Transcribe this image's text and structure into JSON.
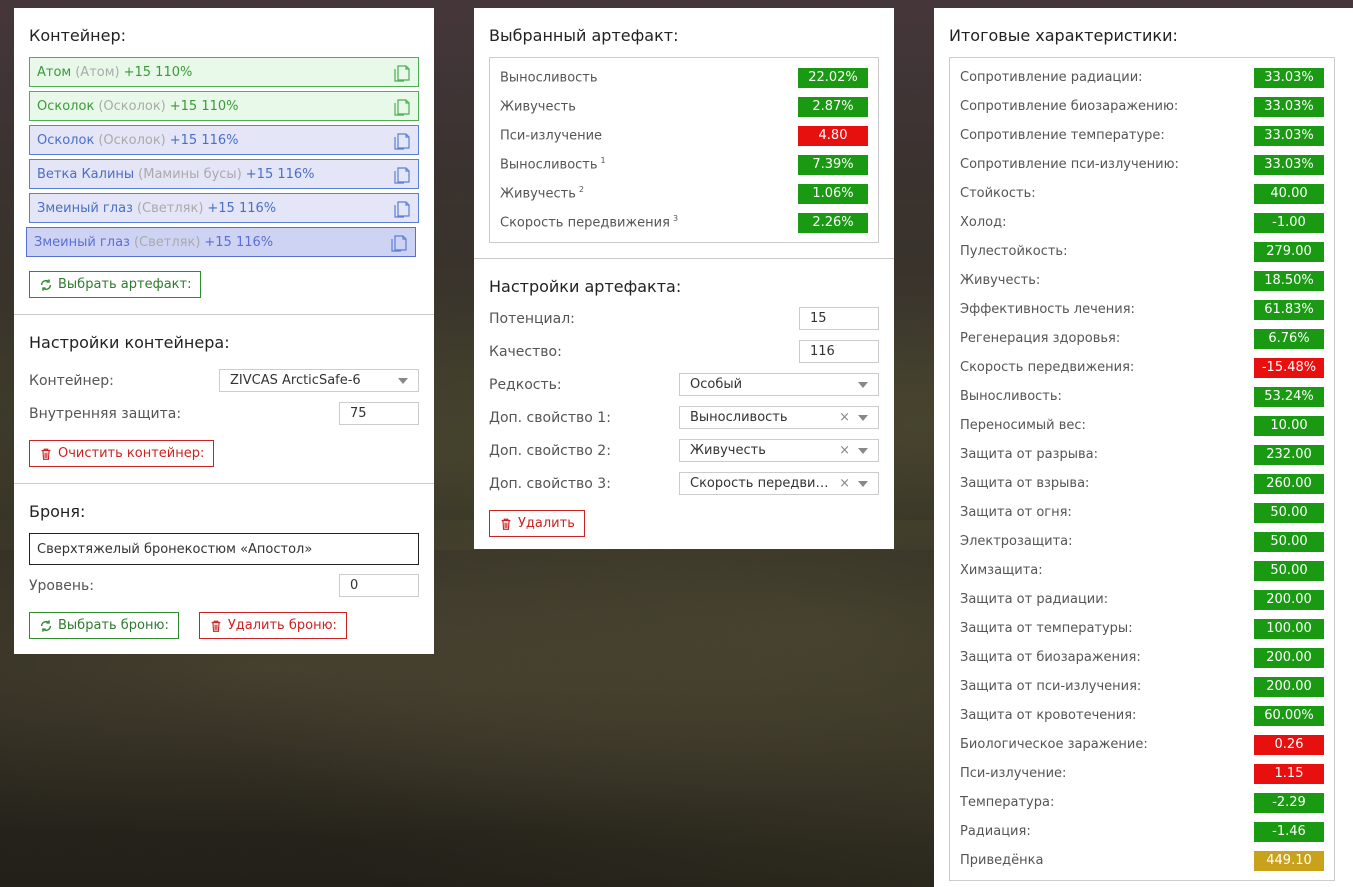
{
  "colors": {
    "green": "#1a9a12",
    "red": "#e80f0f",
    "yellow": "#c9a21c"
  },
  "container_panel": {
    "title": "Контейнер:",
    "artifacts": [
      {
        "name": "Атом",
        "alt": "(Атом)",
        "stats": "+15 110%",
        "style": "green"
      },
      {
        "name": "Осколок",
        "alt": "(Осколок)",
        "stats": "+15 110%",
        "style": "green"
      },
      {
        "name": "Осколок",
        "alt": "(Осколок)",
        "stats": "+15 116%",
        "style": "blue"
      },
      {
        "name": "Ветка Калины",
        "alt": "(Мамины бусы)",
        "stats": "+15 116%",
        "style": "blue"
      },
      {
        "name": "Змеиный глаз",
        "alt": "(Светляк)",
        "stats": "+15 116%",
        "style": "blue"
      },
      {
        "name": "Змеиный глаз",
        "alt": "(Светляк)",
        "stats": "+15 116%",
        "style": "sel"
      }
    ],
    "select_artifact_btn": "Выбрать артефакт:",
    "settings_title": "Настройки контейнера:",
    "container_label": "Контейнер:",
    "container_value": "ZIVCAS ArcticSafe-6",
    "inner_protection_label": "Внутренняя защита:",
    "inner_protection_value": "75",
    "clear_btn": "Очистить контейнер:",
    "armor_title": "Броня:",
    "armor_value": "Сверхтяжелый бронекостюм «Апостол»",
    "level_label": "Уровень:",
    "level_value": "0",
    "select_armor_btn": "Выбрать броню:",
    "delete_armor_btn": "Удалить броню:"
  },
  "artifact_panel": {
    "title": "Выбранный артефакт:",
    "stats": [
      {
        "label": "Выносливость",
        "sup": "",
        "value": "22.02%",
        "color": "g"
      },
      {
        "label": "Живучесть",
        "sup": "",
        "value": "2.87%",
        "color": "g"
      },
      {
        "label": "Пси-излучение",
        "sup": "",
        "value": "4.80",
        "color": "r"
      },
      {
        "label": "Выносливость",
        "sup": "1",
        "value": "7.39%",
        "color": "g"
      },
      {
        "label": "Живучесть",
        "sup": "2",
        "value": "1.06%",
        "color": "g"
      },
      {
        "label": "Скорость передвижения",
        "sup": "3",
        "value": "2.26%",
        "color": "g"
      }
    ],
    "settings_title": "Настройки артефакта:",
    "potential_label": "Потенциал:",
    "potential_value": "15",
    "quality_label": "Качество:",
    "quality_value": "116",
    "rarity_label": "Редкость:",
    "rarity_value": "Особый",
    "extra1_label": "Доп. свойство 1:",
    "extra1_value": "Выносливость",
    "extra2_label": "Доп. свойство 2:",
    "extra2_value": "Живучесть",
    "extra3_label": "Доп. свойство 3:",
    "extra3_value": "Скорость передвижения",
    "delete_btn": "Удалить",
    "clear_symbol": "×"
  },
  "totals_panel": {
    "title": "Итоговые характеристики:",
    "stats": [
      {
        "label": "Сопротивление радиации:",
        "value": "33.03%",
        "color": "g"
      },
      {
        "label": "Сопротивление биозаражению:",
        "value": "33.03%",
        "color": "g"
      },
      {
        "label": "Сопротивление температуре:",
        "value": "33.03%",
        "color": "g"
      },
      {
        "label": "Сопротивление пси-излучению:",
        "value": "33.03%",
        "color": "g"
      },
      {
        "label": "Стойкость:",
        "value": "40.00",
        "color": "g"
      },
      {
        "label": "Холод:",
        "value": "-1.00",
        "color": "g"
      },
      {
        "label": "Пулестойкость:",
        "value": "279.00",
        "color": "g"
      },
      {
        "label": "Живучесть:",
        "value": "18.50%",
        "color": "g"
      },
      {
        "label": "Эффективность лечения:",
        "value": "61.83%",
        "color": "g"
      },
      {
        "label": "Регенерация здоровья:",
        "value": "6.76%",
        "color": "g"
      },
      {
        "label": "Скорость передвижения:",
        "value": "-15.48%",
        "color": "r"
      },
      {
        "label": "Выносливость:",
        "value": "53.24%",
        "color": "g"
      },
      {
        "label": "Переносимый вес:",
        "value": "10.00",
        "color": "g"
      },
      {
        "label": "Защита от разрыва:",
        "value": "232.00",
        "color": "g"
      },
      {
        "label": "Защита от взрыва:",
        "value": "260.00",
        "color": "g"
      },
      {
        "label": "Защита от огня:",
        "value": "50.00",
        "color": "g"
      },
      {
        "label": "Электрозащита:",
        "value": "50.00",
        "color": "g"
      },
      {
        "label": "Химзащита:",
        "value": "50.00",
        "color": "g"
      },
      {
        "label": "Защита от радиации:",
        "value": "200.00",
        "color": "g"
      },
      {
        "label": "Защита от температуры:",
        "value": "100.00",
        "color": "g"
      },
      {
        "label": "Защита от биозаражения:",
        "value": "200.00",
        "color": "g"
      },
      {
        "label": "Защита от пси-излучения:",
        "value": "200.00",
        "color": "g"
      },
      {
        "label": "Защита от кровотечения:",
        "value": "60.00%",
        "color": "g"
      },
      {
        "label": "Биологическое заражение:",
        "value": "0.26",
        "color": "r"
      },
      {
        "label": "Пси-излучение:",
        "value": "1.15",
        "color": "r"
      },
      {
        "label": "Температура:",
        "value": "-2.29",
        "color": "g"
      },
      {
        "label": "Радиация:",
        "value": "-1.46",
        "color": "g"
      },
      {
        "label": "Приведёнка",
        "value": "449.10",
        "color": "y"
      }
    ]
  }
}
